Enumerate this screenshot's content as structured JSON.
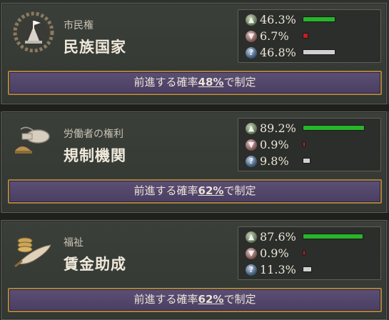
{
  "policies": [
    {
      "category": "市民権",
      "name": "民族国家",
      "icon": "fortress-chain-icon",
      "stats": {
        "support": {
          "value": "46.3%",
          "fraction": 0.463
        },
        "oppose": {
          "value": "6.7%",
          "fraction": 0.067
        },
        "undecided": {
          "value": "46.8%",
          "fraction": 0.468
        }
      },
      "action": {
        "prefix": "前進する確率",
        "chance": "48%",
        "suffix": "で制定"
      }
    },
    {
      "category": "労働者の権利",
      "name": "規制機関",
      "icon": "whistle-helmet-icon",
      "stats": {
        "support": {
          "value": "89.2%",
          "fraction": 0.892
        },
        "oppose": {
          "value": "0.9%",
          "fraction": 0.009
        },
        "undecided": {
          "value": "9.8%",
          "fraction": 0.098
        }
      },
      "action": {
        "prefix": "前進する確率",
        "chance": "62%",
        "suffix": "で制定"
      }
    },
    {
      "category": "福祉",
      "name": "賃金助成",
      "icon": "coins-bread-icon",
      "stats": {
        "support": {
          "value": "87.6%",
          "fraction": 0.876
        },
        "oppose": {
          "value": "0.9%",
          "fraction": 0.009
        },
        "undecided": {
          "value": "11.3%",
          "fraction": 0.113
        }
      },
      "action": {
        "prefix": "前進する確率",
        "chance": "62%",
        "suffix": "で制定"
      }
    }
  ],
  "colors": {
    "support": "#27b529",
    "oppose": "#c02020",
    "undecided": "#d0d0d0",
    "action_bg": "#54476c",
    "action_border": "#a8823e"
  }
}
